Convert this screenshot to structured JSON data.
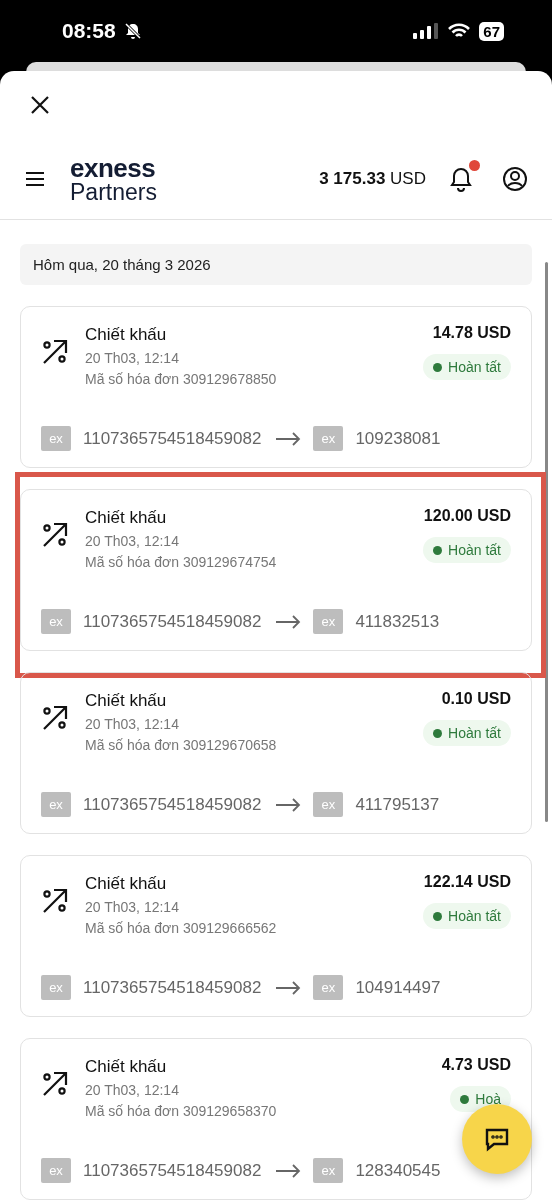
{
  "status_bar": {
    "time": "08:58",
    "battery": "67"
  },
  "header": {
    "logo_top": "exness",
    "logo_bottom": "Partners",
    "balance_amount": "3 175.33",
    "balance_currency": "USD",
    "notification_dot": true
  },
  "date_header": "Hôm qua, 20 tháng 3 2026",
  "transactions": [
    {
      "title": "Chiết khấu",
      "datetime": "20 Th03, 12:14",
      "invoice": "Mã số hóa đơn 309129678850",
      "amount": "14.78 USD",
      "status": "Hoàn tất",
      "from_badge": "ex",
      "from_id": "1107365754518459082",
      "to_badge": "ex",
      "to_id": "109238081",
      "highlighted": false
    },
    {
      "title": "Chiết khấu",
      "datetime": "20 Th03, 12:14",
      "invoice": "Mã số hóa đơn 309129674754",
      "amount": "120.00 USD",
      "status": "Hoàn tất",
      "from_badge": "ex",
      "from_id": "1107365754518459082",
      "to_badge": "ex",
      "to_id": "411832513",
      "highlighted": true
    },
    {
      "title": "Chiết khấu",
      "datetime": "20 Th03, 12:14",
      "invoice": "Mã số hóa đơn 309129670658",
      "amount": "0.10 USD",
      "status": "Hoàn tất",
      "from_badge": "ex",
      "from_id": "1107365754518459082",
      "to_badge": "ex",
      "to_id": "411795137",
      "highlighted": false
    },
    {
      "title": "Chiết khấu",
      "datetime": "20 Th03, 12:14",
      "invoice": "Mã số hóa đơn 309129666562",
      "amount": "122.14 USD",
      "status": "Hoàn tất",
      "from_badge": "ex",
      "from_id": "1107365754518459082",
      "to_badge": "ex",
      "to_id": "104914497",
      "highlighted": false
    },
    {
      "title": "Chiết khấu",
      "datetime": "20 Th03, 12:14",
      "invoice": "Mã số hóa đơn 309129658370",
      "amount": "4.73 USD",
      "status": "Hoà",
      "from_badge": "ex",
      "from_id": "1107365754518459082",
      "to_badge": "ex",
      "to_id": "128340545",
      "highlighted": false
    }
  ]
}
